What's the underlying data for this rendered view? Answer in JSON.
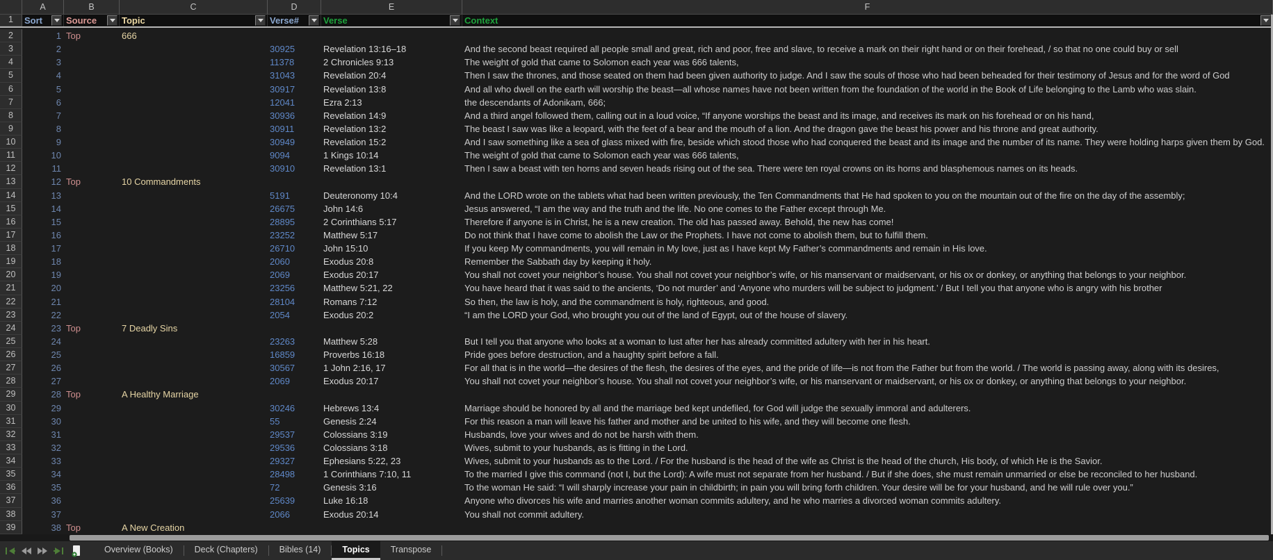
{
  "palette": {
    "grid_bg": "#1c1c1c",
    "header_strip_bg": "#2d2d2d",
    "header_row_bg": "#0f0f0f",
    "freeze_line": "#b7b7b7",
    "accent_green": "#1ea33c",
    "nav_arrow_green": "#4e7e38",
    "scroll_thumb": "#9c9c9c"
  },
  "sheet": {
    "header_row_number": "1",
    "columns": [
      {
        "letter": "A",
        "label": "Sort",
        "header_color": "#8ba7cf",
        "text_color": "#6e86ae",
        "align": "right"
      },
      {
        "letter": "B",
        "label": "Source",
        "header_color": "#de9a96",
        "text_color": "#cf8f8f",
        "align": "left"
      },
      {
        "letter": "C",
        "label": "Topic",
        "header_color": "#ecd9a4",
        "text_color": "#e6d5a5",
        "align": "left"
      },
      {
        "letter": "D",
        "label": "Verse#",
        "header_color": "#8ba7cf",
        "text_color": "#5f88c8",
        "align": "left"
      },
      {
        "letter": "E",
        "label": "Verse",
        "header_color": "#1ea33c",
        "text_color": "#d8d8d8",
        "align": "left"
      },
      {
        "letter": "F",
        "label": "Context",
        "header_color": "#1ea33c",
        "text_color": "#cdcdcd",
        "align": "left"
      }
    ],
    "rows": [
      {
        "n": "2",
        "cells": [
          "1",
          "Top",
          "666",
          "",
          "",
          ""
        ]
      },
      {
        "n": "3",
        "cells": [
          "2",
          "",
          "",
          "30925",
          "Revelation 13:16–18",
          "And the second beast required all people small and great, rich and poor, free and slave, to receive a mark on their right hand or on their forehead, / so that no one could buy or sell"
        ]
      },
      {
        "n": "4",
        "cells": [
          "3",
          "",
          "",
          "11378",
          "2 Chronicles 9:13",
          "The weight of gold that came to Solomon each year was 666 talents,"
        ]
      },
      {
        "n": "5",
        "cells": [
          "4",
          "",
          "",
          "31043",
          "Revelation 20:4",
          "Then I saw the thrones, and those seated on them had been given authority to judge. And I saw the souls of those who had been beheaded for their testimony of Jesus and for the word of God"
        ]
      },
      {
        "n": "6",
        "cells": [
          "5",
          "",
          "",
          "30917",
          "Revelation 13:8",
          "And all who dwell on the earth will worship the beast—all whose names have not been written from the foundation of the world in the Book of Life belonging to the Lamb who was slain."
        ]
      },
      {
        "n": "7",
        "cells": [
          "6",
          "",
          "",
          "12041",
          "Ezra 2:13",
          "the descendants of Adonikam, 666;"
        ]
      },
      {
        "n": "8",
        "cells": [
          "7",
          "",
          "",
          "30936",
          "Revelation 14:9",
          "And a third angel followed them, calling out in a loud voice, “If anyone worships the beast and its image, and receives its mark on his forehead or on his hand,"
        ]
      },
      {
        "n": "9",
        "cells": [
          "8",
          "",
          "",
          "30911",
          "Revelation 13:2",
          "The beast I saw was like a leopard, with the feet of a bear and the mouth of a lion. And the dragon gave the beast his power and his throne and great authority."
        ]
      },
      {
        "n": "10",
        "cells": [
          "9",
          "",
          "",
          "30949",
          "Revelation 15:2",
          "And I saw something like a sea of glass mixed with fire, beside which stood those who had conquered the beast and its image and the number of its name. They were holding harps given them by God."
        ]
      },
      {
        "n": "11",
        "cells": [
          "10",
          "",
          "",
          "9094",
          "1 Kings 10:14",
          "The weight of gold that came to Solomon each year was 666 talents,"
        ]
      },
      {
        "n": "12",
        "cells": [
          "11",
          "",
          "",
          "30910",
          "Revelation 13:1",
          "Then I saw a beast with ten horns and seven heads rising out of the sea. There were ten royal crowns on its horns and blasphemous names on its heads."
        ]
      },
      {
        "n": "13",
        "cells": [
          "12",
          "Top",
          "10 Commandments",
          "",
          "",
          ""
        ]
      },
      {
        "n": "14",
        "cells": [
          "13",
          "",
          "",
          "5191",
          "Deuteronomy 10:4",
          "And the LORD wrote on the tablets what had been written previously, the Ten Commandments that He had spoken to you on the mountain out of the fire on the day of the assembly;"
        ]
      },
      {
        "n": "15",
        "cells": [
          "14",
          "",
          "",
          "26675",
          "John 14:6",
          "Jesus answered, “I am the way and the truth and the life. No one comes to the Father except through Me."
        ]
      },
      {
        "n": "16",
        "cells": [
          "15",
          "",
          "",
          "28895",
          "2 Corinthians 5:17",
          "Therefore if anyone is in Christ, he is a new creation. The old has passed away. Behold, the new has come!"
        ]
      },
      {
        "n": "17",
        "cells": [
          "16",
          "",
          "",
          "23252",
          "Matthew 5:17",
          "Do not think that I have come to abolish the Law or the Prophets. I have not come to abolish them, but to fulfill them."
        ]
      },
      {
        "n": "18",
        "cells": [
          "17",
          "",
          "",
          "26710",
          "John 15:10",
          "If you keep My commandments, you will remain in My love, just as I have kept My Father’s commandments and remain in His love."
        ]
      },
      {
        "n": "19",
        "cells": [
          "18",
          "",
          "",
          "2060",
          "Exodus 20:8",
          "Remember the Sabbath day by keeping it holy."
        ]
      },
      {
        "n": "20",
        "cells": [
          "19",
          "",
          "",
          "2069",
          "Exodus 20:17",
          "You shall not covet your neighbor’s house. You shall not covet your neighbor’s wife, or his manservant or maidservant, or his ox or donkey, or anything that belongs to your neighbor."
        ]
      },
      {
        "n": "21",
        "cells": [
          "20",
          "",
          "",
          "23256",
          "Matthew 5:21, 22",
          "You have heard that it was said to the ancients, ‘Do not murder’ and ‘Anyone who murders will be subject to judgment.’ / But I tell you that anyone who is angry with his brother"
        ]
      },
      {
        "n": "22",
        "cells": [
          "21",
          "",
          "",
          "28104",
          "Romans 7:12",
          "So then, the law is holy, and the commandment is holy, righteous, and good."
        ]
      },
      {
        "n": "23",
        "cells": [
          "22",
          "",
          "",
          "2054",
          "Exodus 20:2",
          "“I am the LORD your God, who brought you out of the land of Egypt, out of the house of slavery."
        ]
      },
      {
        "n": "24",
        "cells": [
          "23",
          "Top",
          "7 Deadly Sins",
          "",
          "",
          ""
        ]
      },
      {
        "n": "25",
        "cells": [
          "24",
          "",
          "",
          "23263",
          "Matthew 5:28",
          "But I tell you that anyone who looks at a woman to lust after her has already committed adultery with her in his heart."
        ]
      },
      {
        "n": "26",
        "cells": [
          "25",
          "",
          "",
          "16859",
          "Proverbs 16:18",
          "Pride goes before destruction, and a haughty spirit before a fall."
        ]
      },
      {
        "n": "27",
        "cells": [
          "26",
          "",
          "",
          "30567",
          "1 John 2:16, 17",
          "For all that is in the world—the desires of the flesh, the desires of the eyes, and the pride of life—is not from the Father but from the world. / The world is passing away, along with its desires,"
        ]
      },
      {
        "n": "28",
        "cells": [
          "27",
          "",
          "",
          "2069",
          "Exodus 20:17",
          "You shall not covet your neighbor’s house. You shall not covet your neighbor’s wife, or his manservant or maidservant, or his ox or donkey, or anything that belongs to your neighbor."
        ]
      },
      {
        "n": "29",
        "cells": [
          "28",
          "Top",
          "A Healthy Marriage",
          "",
          "",
          ""
        ]
      },
      {
        "n": "30",
        "cells": [
          "29",
          "",
          "",
          "30246",
          "Hebrews 13:4",
          "Marriage should be honored by all and the marriage bed kept undefiled, for God will judge the sexually immoral and adulterers."
        ]
      },
      {
        "n": "31",
        "cells": [
          "30",
          "",
          "",
          "55",
          "Genesis 2:24",
          "For this reason a man will leave his father and mother and be united to his wife, and they will become one flesh."
        ]
      },
      {
        "n": "32",
        "cells": [
          "31",
          "",
          "",
          "29537",
          "Colossians 3:19",
          "Husbands, love your wives and do not be harsh with them."
        ]
      },
      {
        "n": "33",
        "cells": [
          "32",
          "",
          "",
          "29536",
          "Colossians 3:18",
          "Wives, submit to your husbands, as is fitting in the Lord."
        ]
      },
      {
        "n": "34",
        "cells": [
          "33",
          "",
          "",
          "29327",
          "Ephesians 5:22, 23",
          "Wives, submit to your husbands as to the Lord. / For the husband is the head of the wife as Christ is the head of the church, His body, of which He is the Savior."
        ]
      },
      {
        "n": "35",
        "cells": [
          "34",
          "",
          "",
          "28498",
          "1 Corinthians 7:10, 11",
          "To the married I give this command (not I, but the Lord): A wife must not separate from her husband. / But if she does, she must remain unmarried or else be reconciled to her husband."
        ]
      },
      {
        "n": "36",
        "cells": [
          "35",
          "",
          "",
          "72",
          "Genesis 3:16",
          "To the woman He said: “I will sharply increase your pain in childbirth; in pain you will bring forth children. Your desire will be for your husband, and he will rule over you.”"
        ]
      },
      {
        "n": "37",
        "cells": [
          "36",
          "",
          "",
          "25639",
          "Luke 16:18",
          "Anyone who divorces his wife and marries another woman commits adultery, and he who marries a divorced woman commits adultery."
        ]
      },
      {
        "n": "38",
        "cells": [
          "37",
          "",
          "",
          "2066",
          "Exodus 20:14",
          "You shall not commit adultery."
        ]
      },
      {
        "n": "39",
        "cells": [
          "38",
          "Top",
          "A New Creation",
          "",
          "",
          ""
        ]
      }
    ]
  },
  "sheet_tabs": {
    "tabs": [
      {
        "label": "Overview (Books)",
        "active": false,
        "sep_after": true
      },
      {
        "label": "Deck (Chapters)",
        "active": false,
        "sep_after": true
      },
      {
        "label": "Bibles (14)",
        "active": false,
        "sep_after": true
      },
      {
        "label": "Topics",
        "active": true,
        "sep_after": false
      },
      {
        "label": "Transpose",
        "active": false,
        "sep_after": true
      }
    ]
  }
}
